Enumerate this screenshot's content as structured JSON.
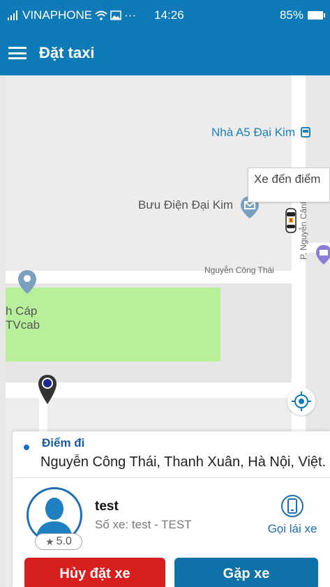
{
  "statusbar": {
    "carrier": "VINAPHONE",
    "dots": "···",
    "time": "14:26",
    "battery": "85%"
  },
  "appbar": {
    "title": "Đặt taxi"
  },
  "map": {
    "poi_a5": "Nhà A5 Đại Kim",
    "poi_post": "Bưu Điện Đại Kim",
    "street_nguyen_cong_thai": "Nguyễn Công Thái",
    "street_nguyen_canh_di": "P. Nguyễn Cảnh Dị",
    "poi_tvcab_line1": "h Cáp",
    "poi_tvcab_line2": "TVcab",
    "tooltip": "Xe đến điểm"
  },
  "origin": {
    "label": "Điểm đi",
    "address": "Nguyễn Công Thái, Thanh Xuân, Hà Nội, Việt..."
  },
  "driver": {
    "name": "test",
    "plate": "Số xe: test - TEST",
    "rating": "5.0",
    "call_label": "Gọi lái xe"
  },
  "actions": {
    "cancel_label": "Hủy đặt xe",
    "meet_label": "Gặp xe"
  },
  "colors": {
    "primary": "#0e7ab8",
    "danger": "#d81f1f",
    "park": "#b7ef9b"
  }
}
